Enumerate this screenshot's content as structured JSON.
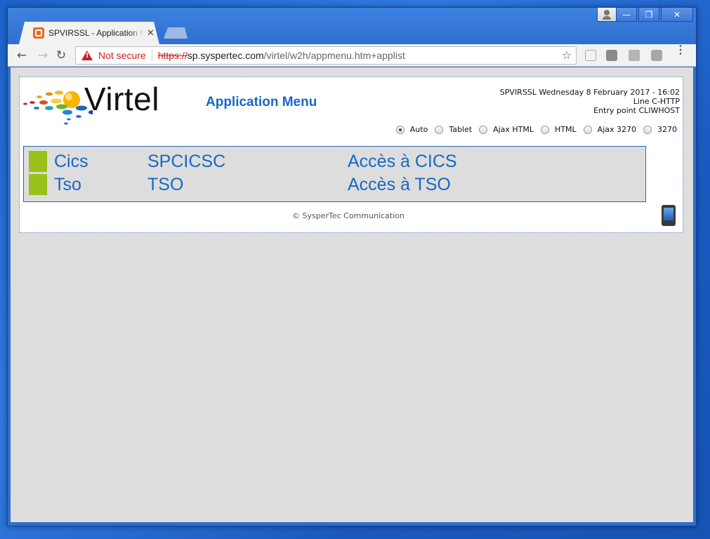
{
  "browser": {
    "tab": {
      "title": "SPVIRSSL - Application Menu",
      "close_glyph": "✕"
    },
    "address_bar": {
      "security_label": "Not secure",
      "url_scheme": "https://",
      "url_host": "sp.syspertec.com",
      "url_path": "/virtel/w2h/appmenu.htm+applist"
    },
    "nav": {
      "back_glyph": "←",
      "forward_glyph": "→",
      "reload_glyph": "↻"
    },
    "star_glyph": "☆",
    "menu_glyph": "⋮",
    "window_controls": {
      "minimize": "—",
      "maximize": "❐",
      "close": "✕"
    }
  },
  "page": {
    "logo_text": "Virtel",
    "title": "Application Menu",
    "info": {
      "line1": "SPVIRSSL Wednesday 8 February 2017 - 16:02",
      "line2": "Line C-HTTP",
      "line3": "Entry point CLIWHOST"
    },
    "modes": [
      {
        "label": "Auto",
        "checked": true
      },
      {
        "label": "Tablet",
        "checked": false
      },
      {
        "label": "Ajax HTML",
        "checked": false
      },
      {
        "label": "HTML",
        "checked": false
      },
      {
        "label": "Ajax 3270",
        "checked": false
      },
      {
        "label": "3270",
        "checked": false
      }
    ],
    "applications": [
      {
        "name": "Cics",
        "id": "SPCICSC",
        "description": "Accès à CICS"
      },
      {
        "name": "Tso",
        "id": "TSO",
        "description": "Accès à TSO"
      }
    ],
    "copyright": "© SysperTec Communication"
  },
  "colors": {
    "accent_blue": "#1668c6",
    "marker_green": "#9ac11a",
    "warning_red": "#c5221f",
    "desktop_blue": "#1c63c9"
  }
}
